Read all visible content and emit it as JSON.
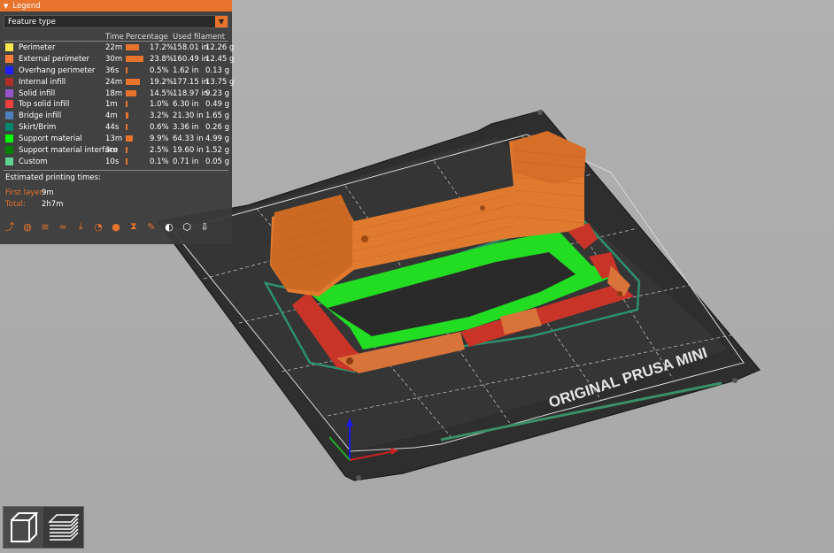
{
  "legend": {
    "title": "Legend",
    "view_type": "Feature type",
    "columns": [
      "Time",
      "Percentage",
      "Used filament"
    ],
    "rows": [
      {
        "name": "Perimeter",
        "color": "#ffe64d",
        "time": "22m",
        "pct": "17.2%",
        "pct_value": 17.2,
        "length": "158.01 in",
        "weight": "12.26 g"
      },
      {
        "name": "External perimeter",
        "color": "#ff7d38",
        "time": "30m",
        "pct": "23.8%",
        "pct_value": 23.8,
        "length": "160.49 in",
        "weight": "12.45 g"
      },
      {
        "name": "Overhang perimeter",
        "color": "#1f1fff",
        "time": "36s",
        "pct": "0.5%",
        "pct_value": 0.5,
        "length": "1.62 in",
        "weight": "0.13 g"
      },
      {
        "name": "Internal infill",
        "color": "#b03029",
        "time": "24m",
        "pct": "19.2%",
        "pct_value": 19.2,
        "length": "177.15 in",
        "weight": "13.75 g"
      },
      {
        "name": "Solid infill",
        "color": "#9654cc",
        "time": "18m",
        "pct": "14.5%",
        "pct_value": 14.5,
        "length": "118.97 in",
        "weight": "9.23 g"
      },
      {
        "name": "Top solid infill",
        "color": "#f04040",
        "time": "1m",
        "pct": "1.0%",
        "pct_value": 1.0,
        "length": "6.30 in",
        "weight": "0.49 g"
      },
      {
        "name": "Bridge infill",
        "color": "#4d80ba",
        "time": "4m",
        "pct": "3.2%",
        "pct_value": 3.2,
        "length": "21.30 in",
        "weight": "1.65 g"
      },
      {
        "name": "Skirt/Brim",
        "color": "#00876e",
        "time": "44s",
        "pct": "0.6%",
        "pct_value": 0.6,
        "length": "3.36 in",
        "weight": "0.26 g"
      },
      {
        "name": "Support material",
        "color": "#00ff00",
        "time": "13m",
        "pct": "9.9%",
        "pct_value": 9.9,
        "length": "64.33 in",
        "weight": "4.99 g"
      },
      {
        "name": "Support material interface",
        "color": "#008000",
        "time": "3m",
        "pct": "2.5%",
        "pct_value": 2.5,
        "length": "19.60 in",
        "weight": "1.52 g"
      },
      {
        "name": "Custom",
        "color": "#5ed193",
        "time": "10s",
        "pct": "0.1%",
        "pct_value": 0.1,
        "length": "0.71 in",
        "weight": "0.05 g"
      }
    ],
    "estimated_title": "Estimated printing times:",
    "first_layer_label": "First layer:",
    "first_layer_value": "9m",
    "total_label": "Total:",
    "total_value": "2h7m"
  },
  "toolbar_icons": [
    "travel-icon",
    "wipe-icon",
    "retractions-icon",
    "deretractions-icon",
    "seams-icon",
    "tool-changes-icon",
    "color-changes-icon",
    "pause-prints-icon",
    "custom-gcodes-icon",
    "center-of-gravity-icon",
    "shells-icon",
    "tool-marker-icon"
  ],
  "bed_label": "ORIGINAL PRUSA MINI",
  "colors": {
    "accent": "#e8732c",
    "bed": "#2f2f2f",
    "model": "#e07a2e",
    "support": "#22ee22"
  }
}
